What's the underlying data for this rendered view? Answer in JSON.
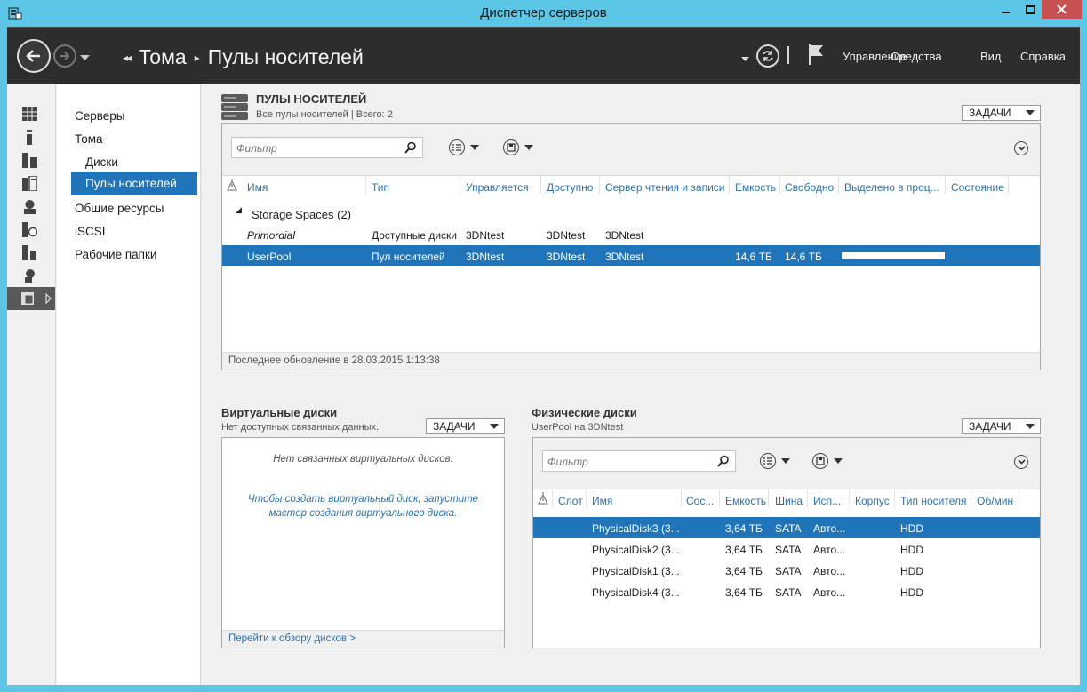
{
  "window": {
    "title": "Диспетчер серверов"
  },
  "header": {
    "breadcrumb": [
      "Тома",
      "Пулы носителей"
    ],
    "menu": [
      "Управление",
      "Средства",
      "Вид",
      "Справка"
    ]
  },
  "nav": {
    "items": [
      "Серверы",
      "Тома",
      "Диски",
      "Пулы носителей",
      "Общие ресурсы",
      "iSCSI",
      "Рабочие папки"
    ]
  },
  "pools": {
    "title": "ПУЛЫ НОСИТЕЛЕЙ",
    "subtitle": "Все пулы носителей | Всего: 2",
    "tasks": "ЗАДАЧИ",
    "filter_placeholder": "Фильтр",
    "columns": [
      "Имя",
      "Тип",
      "Управляется",
      "Доступно",
      "Сервер чтения и записи",
      "Емкость",
      "Свободно",
      "Выделено в проц...",
      "Состояние"
    ],
    "group": "Storage Spaces (2)",
    "rows": [
      {
        "name": "Primordial",
        "type": "Доступные диски",
        "managed": "3DNtest",
        "available": "3DNtest",
        "rw_server": "3DNtest",
        "capacity": "",
        "free": "",
        "allocated_pct": 0,
        "state": ""
      },
      {
        "name": "UserPool",
        "type": "Пул носителей",
        "managed": "3DNtest",
        "available": "3DNtest",
        "rw_server": "3DNtest",
        "capacity": "14,6 ТБ",
        "free": "14,6 ТБ",
        "allocated_pct": 0,
        "state": ""
      }
    ],
    "status": "Последнее обновление в 28.03.2015 1:13:38"
  },
  "vdisks": {
    "title": "Виртуальные диски",
    "subtitle": "Нет доступных связанных данных.",
    "tasks": "ЗАДАЧИ",
    "empty": "Нет связанных виртуальных дисков.",
    "hint_line1": "Чтобы создать виртуальный диск, запустите",
    "hint_line2": "мастер создания виртуального диска.",
    "link": "Перейти к обзору дисков >"
  },
  "pdisks": {
    "title": "Физические диски",
    "subtitle": "UserPool на 3DNtest",
    "tasks": "ЗАДАЧИ",
    "filter_placeholder": "Фильтр",
    "columns": [
      "Слот",
      "Имя",
      "Сос...",
      "Емкость",
      "Шина",
      "Исп...",
      "Корпус",
      "Тип носителя",
      "Об/мин"
    ],
    "rows": [
      {
        "name": "PhysicalDisk3 (3...",
        "capacity": "3,64 ТБ",
        "bus": "SATA",
        "use": "Авто...",
        "media": "HDD"
      },
      {
        "name": "PhysicalDisk2 (3...",
        "capacity": "3,64 ТБ",
        "bus": "SATA",
        "use": "Авто...",
        "media": "HDD"
      },
      {
        "name": "PhysicalDisk1 (3...",
        "capacity": "3,64 ТБ",
        "bus": "SATA",
        "use": "Авто...",
        "media": "HDD"
      },
      {
        "name": "PhysicalDisk4 (3...",
        "capacity": "3,64 ТБ",
        "bus": "SATA",
        "use": "Авто...",
        "media": "HDD"
      }
    ]
  },
  "colors": {
    "accent": "#2075ba",
    "titlebar": "#5bc6e6",
    "header": "#2d2d2d",
    "link": "#2a70b3",
    "close": "#c75050"
  }
}
